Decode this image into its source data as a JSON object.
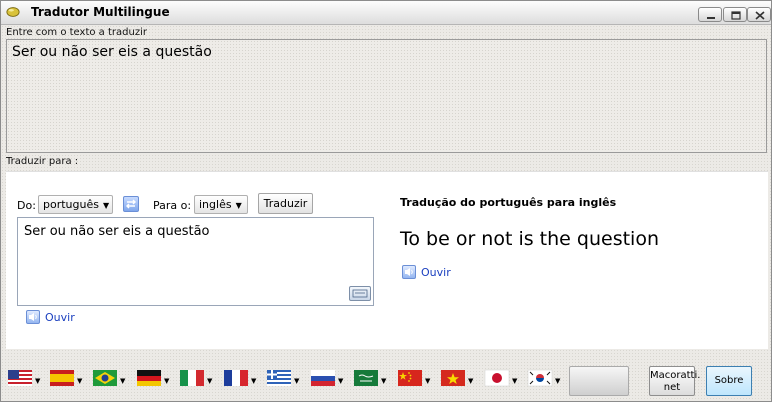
{
  "window": {
    "title": "Tradutor Multilingue"
  },
  "source": {
    "label": "Entre com o texto a traduzir",
    "text": "Ser ou não ser eis a questão"
  },
  "translate_to_label": "Traduzir para :",
  "translator": {
    "from_label": "Do:",
    "from_value": "português",
    "to_label": "Para o:",
    "to_value": "inglês",
    "translate_button": "Traduzir",
    "input_text": "Ser ou não ser eis a questão",
    "listen_label": "Ouvir",
    "result_heading": "Tradução do português para inglês",
    "result_text": "To be or not is the question",
    "result_listen_label": "Ouvir"
  },
  "flags": [
    {
      "name": "flag-usa-icon"
    },
    {
      "name": "flag-spain-icon"
    },
    {
      "name": "flag-brazil-icon"
    },
    {
      "name": "flag-germany-icon"
    },
    {
      "name": "flag-italy-icon"
    },
    {
      "name": "flag-france-icon"
    },
    {
      "name": "flag-greece-icon"
    },
    {
      "name": "flag-russia-icon"
    },
    {
      "name": "flag-saudi-arabia-icon"
    },
    {
      "name": "flag-china-icon"
    },
    {
      "name": "flag-vietnam-icon"
    },
    {
      "name": "flag-japan-icon"
    },
    {
      "name": "flag-south-korea-icon"
    }
  ],
  "buttons": {
    "macoratti": "Macoratti.\nnet",
    "sobre": "Sobre"
  },
  "colors": {
    "link": "#1a3fbf",
    "sobre_button": "#bee6fd"
  }
}
